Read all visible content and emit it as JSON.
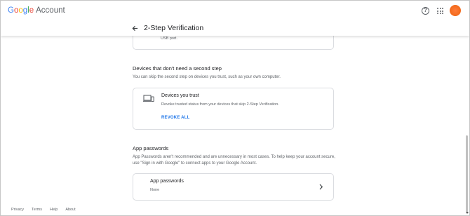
{
  "app": {
    "brand_google": "Google",
    "brand_account": "Account"
  },
  "header": {
    "page_title": "2-Step Verification"
  },
  "top_card": {
    "tail_text": "USB port."
  },
  "devices_section": {
    "title": "Devices that don't need a second step",
    "description": "You can skip the second step on devices you trust, such as your own computer.",
    "card": {
      "title": "Devices you trust",
      "subtitle": "Revoke trusted status from your devices that skip 2-Step Verification.",
      "action_label": "REVOKE ALL"
    }
  },
  "app_passwords_section": {
    "title": "App passwords",
    "description": "App Passwords aren't recommended and are unnecessary in most cases. To help keep your account secure, use \"Sign in with Google\" to connect apps to your Google Account.",
    "card": {
      "title": "App passwords",
      "value": "None"
    }
  },
  "footer": {
    "links": [
      "Privacy",
      "Terms",
      "Help",
      "About"
    ]
  },
  "colors": {
    "link": "#1a73e8",
    "avatar": "#f26a1b"
  },
  "icons": {
    "help": "help-circle-icon",
    "apps": "apps-grid-icon",
    "back": "arrow-back-icon",
    "devices": "devices-icon",
    "chevron": "chevron-right-icon"
  }
}
